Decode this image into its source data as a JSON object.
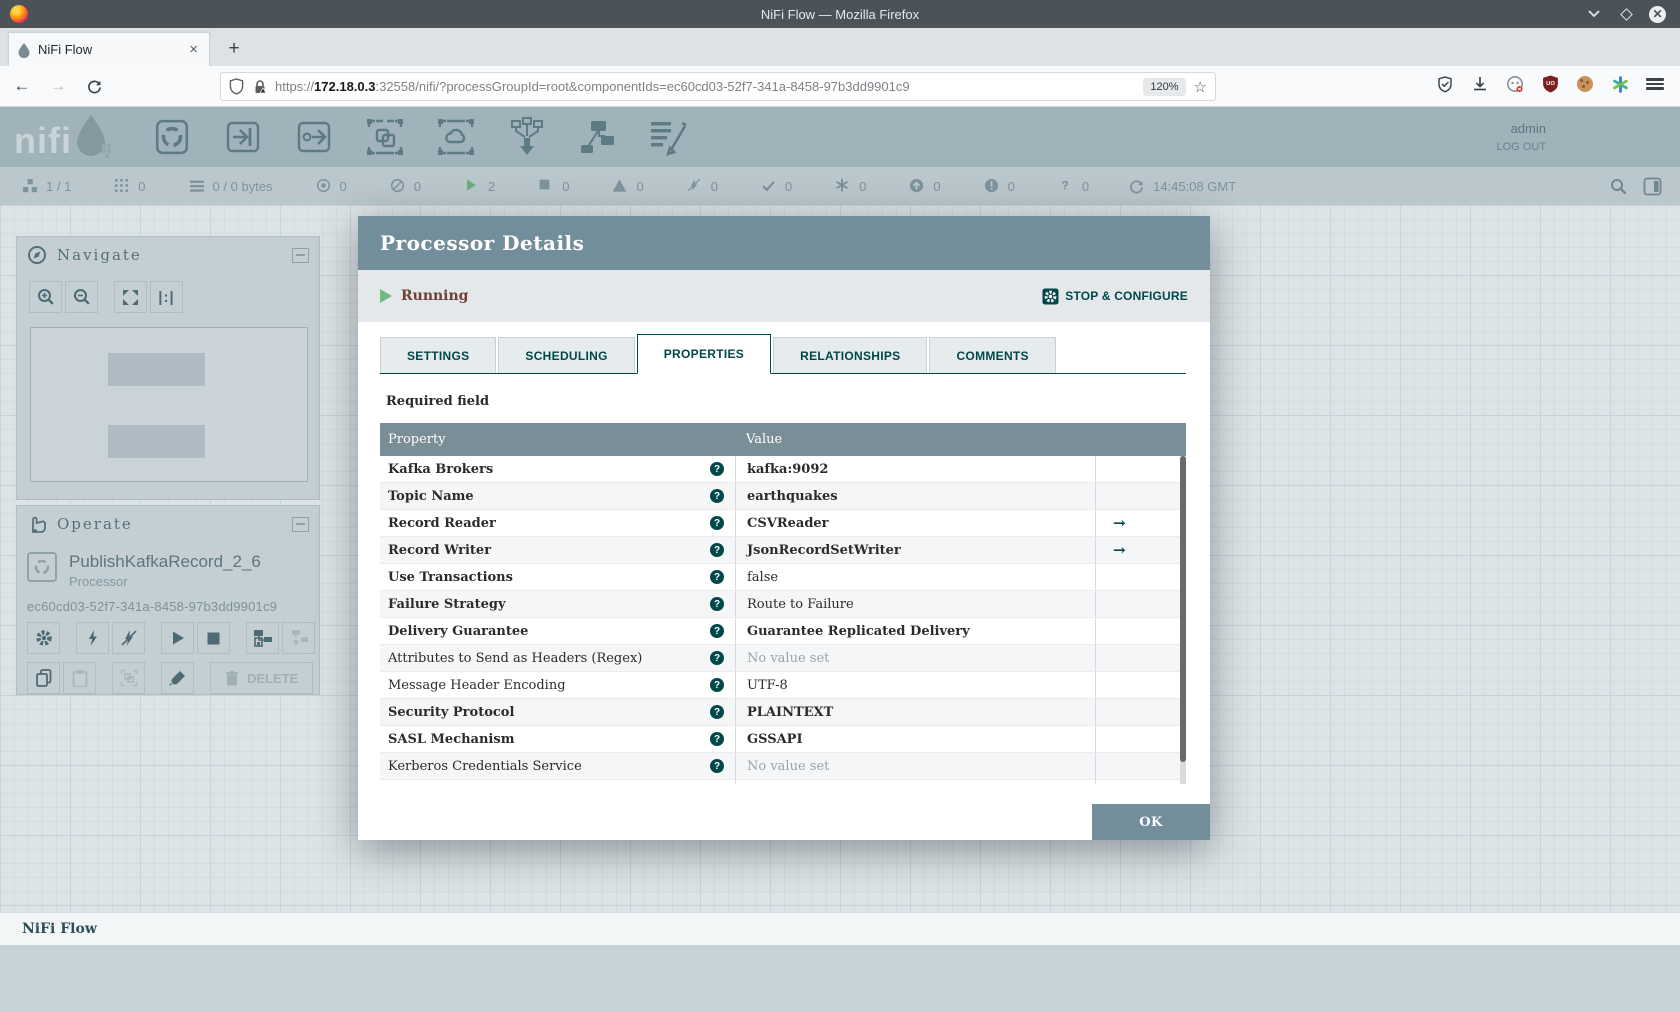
{
  "browser": {
    "window_title": "NiFi Flow — Mozilla Firefox",
    "tab_title": "NiFi Flow",
    "url_scheme": "https://",
    "url_host": "172.18.0.3",
    "url_rest": ":32558/nifi/?processGroupId=root&componentIds=ec60cd03-52f7-341a-8458-97b3dd9901c9",
    "zoom_badge": "120%"
  },
  "nifi": {
    "user": "admin",
    "logout_label": "LOG OUT",
    "stats": [
      {
        "icon": "cluster",
        "value": "1 / 1"
      },
      {
        "icon": "threads",
        "value": "0"
      },
      {
        "icon": "queued",
        "value": "0 / 0 bytes"
      },
      {
        "icon": "transmitting",
        "value": "0"
      },
      {
        "icon": "not-transmitting",
        "value": "0"
      },
      {
        "icon": "running",
        "value": "2"
      },
      {
        "icon": "stopped",
        "value": "0"
      },
      {
        "icon": "invalid",
        "value": "0"
      },
      {
        "icon": "disabled",
        "value": "0"
      },
      {
        "icon": "up-to-date",
        "value": "0"
      },
      {
        "icon": "locally-modified",
        "value": "0"
      },
      {
        "icon": "stale",
        "value": "0"
      },
      {
        "icon": "locally-modified-stale",
        "value": "0"
      },
      {
        "icon": "sync-failure",
        "value": "0"
      }
    ],
    "last_refresh": "14:45:08 GMT",
    "navigate": {
      "title": "Navigate"
    },
    "operate": {
      "title": "Operate",
      "component_name": "PublishKafkaRecord_2_6",
      "component_type": "Processor",
      "component_id": "ec60cd03-52f7-341a-8458-97b3dd9901c9",
      "delete_label": "DELETE"
    },
    "breadcrumb": "NiFi Flow"
  },
  "dialog": {
    "title": "Processor Details",
    "status": "Running",
    "stop_configure_label": "STOP & CONFIGURE",
    "tabs": [
      "SETTINGS",
      "SCHEDULING",
      "PROPERTIES",
      "RELATIONSHIPS",
      "COMMENTS"
    ],
    "active_tab": "PROPERTIES",
    "required_field_label": "Required field",
    "ok_label": "OK",
    "table": {
      "columns": [
        "Property",
        "Value"
      ],
      "rows": [
        {
          "property": "Kafka Brokers",
          "value": "kafka:9092",
          "required": true,
          "emphasis": true,
          "unset": false,
          "goto": false
        },
        {
          "property": "Topic Name",
          "value": "earthquakes",
          "required": true,
          "emphasis": true,
          "unset": false,
          "goto": false
        },
        {
          "property": "Record Reader",
          "value": "CSVReader",
          "required": true,
          "emphasis": true,
          "unset": false,
          "goto": true
        },
        {
          "property": "Record Writer",
          "value": "JsonRecordSetWriter",
          "required": true,
          "emphasis": true,
          "unset": false,
          "goto": true
        },
        {
          "property": "Use Transactions",
          "value": "false",
          "required": true,
          "emphasis": false,
          "unset": false,
          "goto": false
        },
        {
          "property": "Failure Strategy",
          "value": "Route to Failure",
          "required": true,
          "emphasis": false,
          "unset": false,
          "goto": false
        },
        {
          "property": "Delivery Guarantee",
          "value": "Guarantee Replicated Delivery",
          "required": true,
          "emphasis": true,
          "unset": false,
          "goto": false
        },
        {
          "property": "Attributes to Send as Headers (Regex)",
          "value": "No value set",
          "required": false,
          "emphasis": false,
          "unset": true,
          "goto": false
        },
        {
          "property": "Message Header Encoding",
          "value": "UTF-8",
          "required": false,
          "emphasis": false,
          "unset": false,
          "goto": false
        },
        {
          "property": "Security Protocol",
          "value": "PLAINTEXT",
          "required": true,
          "emphasis": true,
          "unset": false,
          "goto": false
        },
        {
          "property": "SASL Mechanism",
          "value": "GSSAPI",
          "required": true,
          "emphasis": true,
          "unset": false,
          "goto": false
        },
        {
          "property": "Kerberos Credentials Service",
          "value": "No value set",
          "required": false,
          "emphasis": false,
          "unset": true,
          "goto": false
        },
        {
          "property": "",
          "value": "",
          "required": false,
          "emphasis": false,
          "unset": true,
          "goto": false,
          "partial": true
        }
      ]
    }
  }
}
